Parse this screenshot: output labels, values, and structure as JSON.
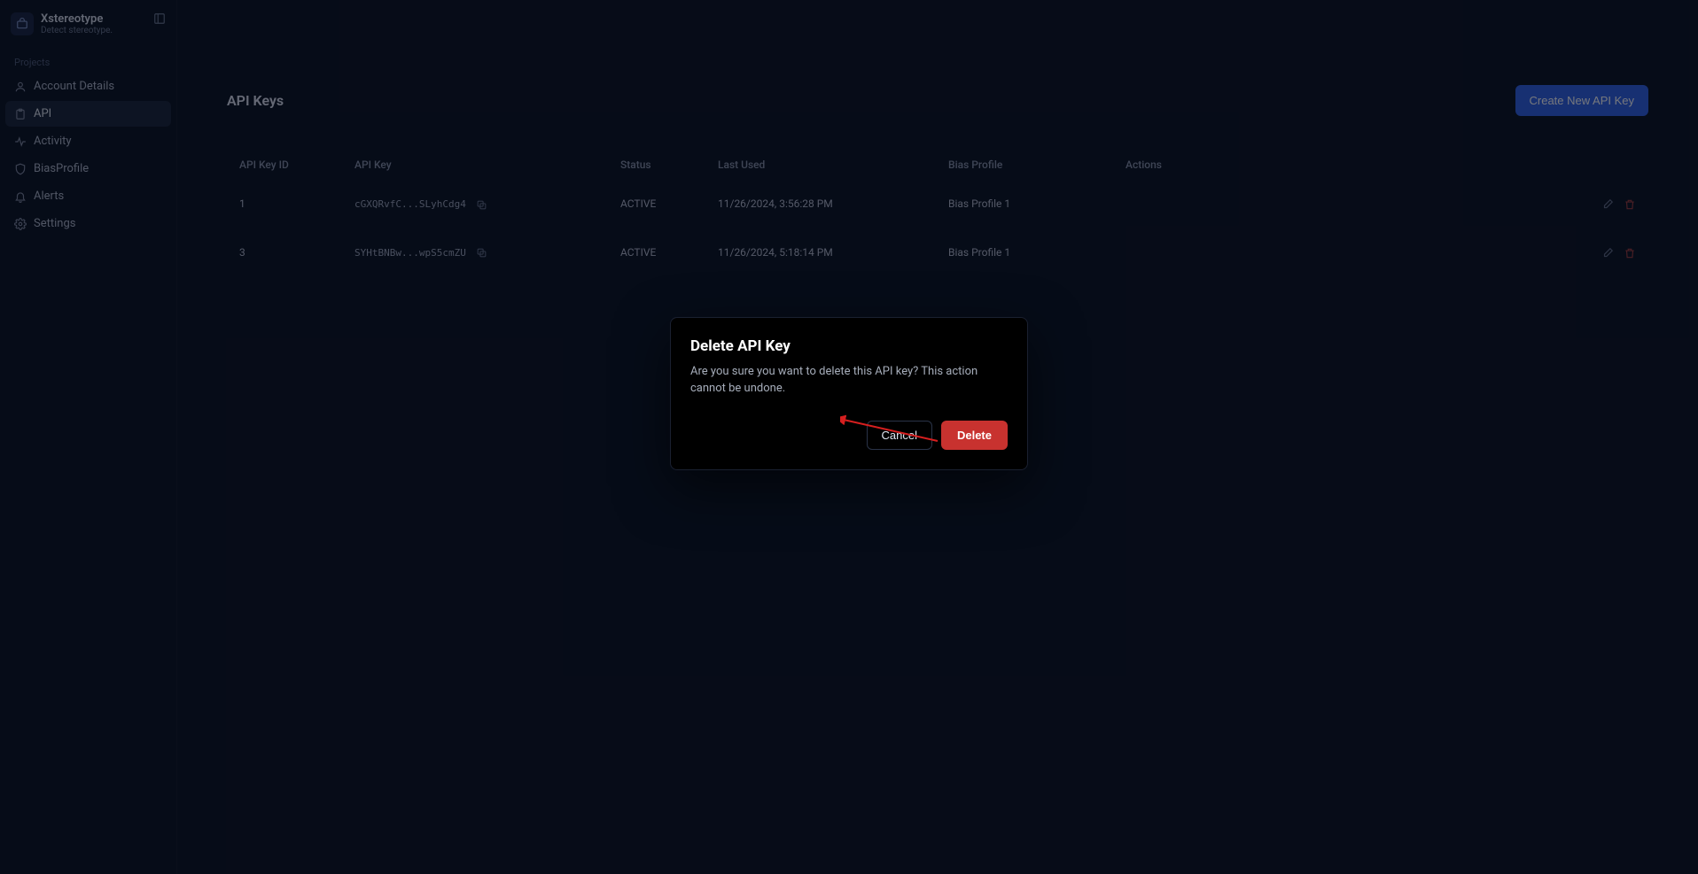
{
  "brand": {
    "title": "Xstereotype",
    "subtitle": "Detect stereotype."
  },
  "sidebar": {
    "section_label": "Projects",
    "items": [
      {
        "label": "Account Details"
      },
      {
        "label": "API"
      },
      {
        "label": "Activity"
      },
      {
        "label": "BiasProfile"
      },
      {
        "label": "Alerts"
      },
      {
        "label": "Settings"
      }
    ]
  },
  "page": {
    "title": "API Keys",
    "create_button": "Create New API Key"
  },
  "table": {
    "headers": {
      "id": "API Key ID",
      "key": "API Key",
      "status": "Status",
      "last_used": "Last Used",
      "profile": "Bias Profile",
      "actions": "Actions"
    },
    "rows": [
      {
        "id": "1",
        "key": "cGXQRvfC...SLyhCdg4",
        "status": "ACTIVE",
        "last_used": "11/26/2024, 3:56:28 PM",
        "profile": "Bias Profile 1"
      },
      {
        "id": "3",
        "key": "SYHtBNBw...wpS5cmZU",
        "status": "ACTIVE",
        "last_used": "11/26/2024, 5:18:14 PM",
        "profile": "Bias Profile 1"
      }
    ]
  },
  "modal": {
    "title": "Delete API Key",
    "body": "Are you sure you want to delete this API key? This action cannot be undone.",
    "cancel": "Cancel",
    "delete": "Delete"
  }
}
